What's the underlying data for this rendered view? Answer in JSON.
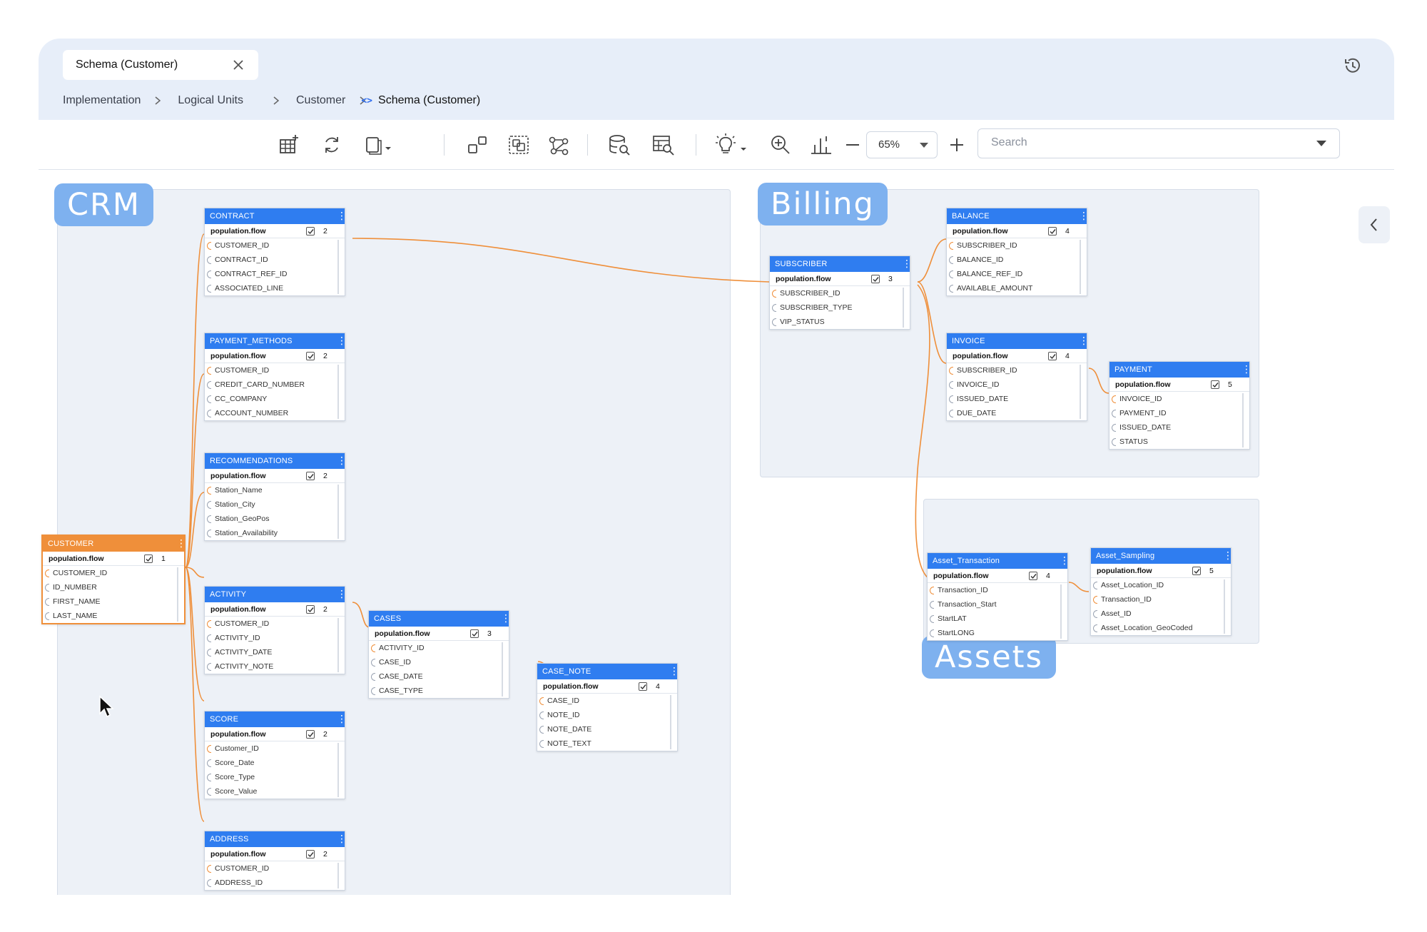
{
  "tab": {
    "label": "Schema (Customer)"
  },
  "breadcrumb": {
    "items": [
      "Implementation",
      "Logical Units",
      "Customer"
    ],
    "current_icon": "<>",
    "current": "Schema (Customer)"
  },
  "toolbar": {
    "zoom": "65%",
    "search_placeholder": "Search",
    "icons": [
      "add-table-icon",
      "refresh-icon",
      "copy-dropdown-icon",
      "group-icon",
      "select-group-icon",
      "graph-icon",
      "database-search-icon",
      "table-search-icon",
      "bulb-dropdown-icon",
      "zoom-in-icon",
      "chart-icon",
      "zoom-minus-icon",
      "zoom-plus-icon"
    ]
  },
  "colors": {
    "accent": "#2f7df0",
    "root": "#ef8f3a",
    "link": "#ef8f3a",
    "region_label": "#7eb1ef",
    "region_bg": "#edf1f7"
  },
  "regions": {
    "crm": "CRM",
    "billing": "Billing",
    "assets": "Assets"
  },
  "tables": {
    "customer": {
      "name": "CUSTOMER",
      "flow": "population.flow",
      "count": "1",
      "fields": [
        "CUSTOMER_ID",
        "ID_NUMBER",
        "FIRST_NAME",
        "LAST_NAME"
      ]
    },
    "contract": {
      "name": "CONTRACT",
      "flow": "population.flow",
      "count": "2",
      "fields": [
        "CUSTOMER_ID",
        "CONTRACT_ID",
        "CONTRACT_REF_ID",
        "ASSOCIATED_LINE"
      ]
    },
    "payment_methods": {
      "name": "PAYMENT_METHODS",
      "flow": "population.flow",
      "count": "2",
      "fields": [
        "CUSTOMER_ID",
        "CREDIT_CARD_NUMBER",
        "CC_COMPANY",
        "ACCOUNT_NUMBER"
      ]
    },
    "recommendations": {
      "name": "RECOMMENDATIONS",
      "flow": "population.flow",
      "count": "2",
      "fields": [
        "Station_Name",
        "Station_City",
        "Station_GeoPos",
        "Station_Availability"
      ]
    },
    "activity": {
      "name": "ACTIVITY",
      "flow": "population.flow",
      "count": "2",
      "fields": [
        "CUSTOMER_ID",
        "ACTIVITY_ID",
        "ACTIVITY_DATE",
        "ACTIVITY_NOTE"
      ]
    },
    "cases": {
      "name": "CASES",
      "flow": "population.flow",
      "count": "3",
      "fields": [
        "ACTIVITY_ID",
        "CASE_ID",
        "CASE_DATE",
        "CASE_TYPE"
      ]
    },
    "case_note": {
      "name": "CASE_NOTE",
      "flow": "population.flow",
      "count": "4",
      "fields": [
        "CASE_ID",
        "NOTE_ID",
        "NOTE_DATE",
        "NOTE_TEXT"
      ]
    },
    "score": {
      "name": "SCORE",
      "flow": "population.flow",
      "count": "2",
      "fields": [
        "Customer_ID",
        "Score_Date",
        "Score_Type",
        "Score_Value"
      ]
    },
    "address": {
      "name": "ADDRESS",
      "flow": "population.flow",
      "count": "2",
      "fields": [
        "CUSTOMER_ID",
        "ADDRESS_ID"
      ]
    },
    "subscriber": {
      "name": "SUBSCRIBER",
      "flow": "population.flow",
      "count": "3",
      "fields": [
        "SUBSCRIBER_ID",
        "SUBSCRIBER_TYPE",
        "VIP_STATUS"
      ]
    },
    "balance": {
      "name": "BALANCE",
      "flow": "population.flow",
      "count": "4",
      "fields": [
        "SUBSCRIBER_ID",
        "BALANCE_ID",
        "BALANCE_REF_ID",
        "AVAILABLE_AMOUNT"
      ]
    },
    "invoice": {
      "name": "INVOICE",
      "flow": "population.flow",
      "count": "4",
      "fields": [
        "SUBSCRIBER_ID",
        "INVOICE_ID",
        "ISSUED_DATE",
        "DUE_DATE"
      ]
    },
    "payment": {
      "name": "PAYMENT",
      "flow": "population.flow",
      "count": "5",
      "fields": [
        "INVOICE_ID",
        "PAYMENT_ID",
        "ISSUED_DATE",
        "STATUS"
      ]
    },
    "asset_transaction": {
      "name": "Asset_Transaction",
      "flow": "population.flow",
      "count": "4",
      "fields": [
        "Transaction_ID",
        "Transaction_Start",
        "StartLAT",
        "StartLONG"
      ]
    },
    "asset_sampling": {
      "name": "Asset_Sampling",
      "flow": "population.flow",
      "count": "5",
      "fields": [
        "Asset_Location_ID",
        "Transaction_ID",
        "Asset_ID",
        "Asset_Location_GeoCoded"
      ]
    }
  }
}
